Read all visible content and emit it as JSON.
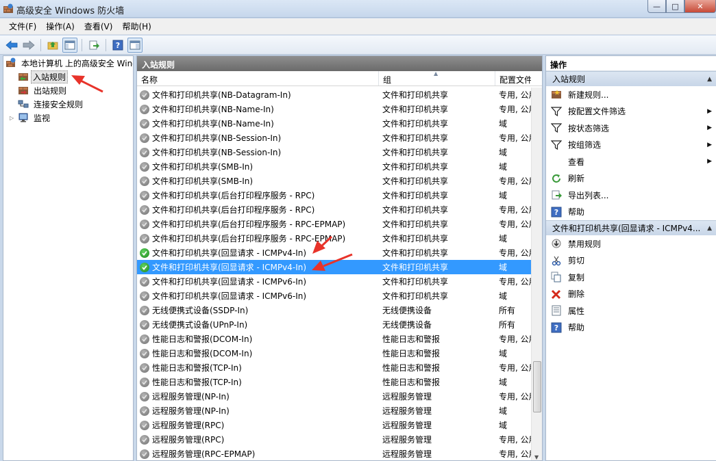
{
  "window": {
    "title": "高级安全 Windows 防火墙",
    "minimize": "—",
    "maximize": "□",
    "close": "✕"
  },
  "menu": [
    "文件(F)",
    "操作(A)",
    "查看(V)",
    "帮助(H)"
  ],
  "toolbar": {
    "buttons": [
      "back-icon",
      "forward-icon",
      "up-folder-icon",
      "show-hide-tree-icon",
      "export-list-icon",
      "help-icon",
      "properties-icon"
    ]
  },
  "tree": {
    "root": "本地计算机 上的高级安全 Windows",
    "items": [
      {
        "label": "入站规则",
        "selected": true
      },
      {
        "label": "出站规则",
        "selected": false
      },
      {
        "label": "连接安全规则",
        "selected": false
      },
      {
        "label": "监视",
        "selected": false,
        "expandable": true
      }
    ]
  },
  "center": {
    "title": "入站规则",
    "columns": {
      "name": "名称",
      "group": "组",
      "profile": "配置文件"
    },
    "rows": [
      {
        "name": "文件和打印机共享(NB-Datagram-In)",
        "group": "文件和打印机共享",
        "profile": "专用, 公用",
        "enabled": false,
        "selected": false
      },
      {
        "name": "文件和打印机共享(NB-Name-In)",
        "group": "文件和打印机共享",
        "profile": "专用, 公用",
        "enabled": false,
        "selected": false
      },
      {
        "name": "文件和打印机共享(NB-Name-In)",
        "group": "文件和打印机共享",
        "profile": "域",
        "enabled": false,
        "selected": false
      },
      {
        "name": "文件和打印机共享(NB-Session-In)",
        "group": "文件和打印机共享",
        "profile": "专用, 公用",
        "enabled": false,
        "selected": false
      },
      {
        "name": "文件和打印机共享(NB-Session-In)",
        "group": "文件和打印机共享",
        "profile": "域",
        "enabled": false,
        "selected": false
      },
      {
        "name": "文件和打印机共享(SMB-In)",
        "group": "文件和打印机共享",
        "profile": "域",
        "enabled": false,
        "selected": false
      },
      {
        "name": "文件和打印机共享(SMB-In)",
        "group": "文件和打印机共享",
        "profile": "专用, 公用",
        "enabled": false,
        "selected": false
      },
      {
        "name": "文件和打印机共享(后台打印程序服务 - RPC)",
        "group": "文件和打印机共享",
        "profile": "域",
        "enabled": false,
        "selected": false
      },
      {
        "name": "文件和打印机共享(后台打印程序服务 - RPC)",
        "group": "文件和打印机共享",
        "profile": "专用, 公用",
        "enabled": false,
        "selected": false
      },
      {
        "name": "文件和打印机共享(后台打印程序服务 - RPC-EPMAP)",
        "group": "文件和打印机共享",
        "profile": "专用, 公用",
        "enabled": false,
        "selected": false
      },
      {
        "name": "文件和打印机共享(后台打印程序服务 - RPC-EPMAP)",
        "group": "文件和打印机共享",
        "profile": "域",
        "enabled": false,
        "selected": false
      },
      {
        "name": "文件和打印机共享(回显请求 - ICMPv4-In)",
        "group": "文件和打印机共享",
        "profile": "专用, 公用",
        "enabled": true,
        "selected": false
      },
      {
        "name": "文件和打印机共享(回显请求 - ICMPv4-In)",
        "group": "文件和打印机共享",
        "profile": "域",
        "enabled": true,
        "selected": true
      },
      {
        "name": "文件和打印机共享(回显请求 - ICMPv6-In)",
        "group": "文件和打印机共享",
        "profile": "专用, 公用",
        "enabled": false,
        "selected": false
      },
      {
        "name": "文件和打印机共享(回显请求 - ICMPv6-In)",
        "group": "文件和打印机共享",
        "profile": "域",
        "enabled": false,
        "selected": false
      },
      {
        "name": "无线便携式设备(SSDP-In)",
        "group": "无线便携设备",
        "profile": "所有",
        "enabled": false,
        "selected": false
      },
      {
        "name": "无线便携式设备(UPnP-In)",
        "group": "无线便携设备",
        "profile": "所有",
        "enabled": false,
        "selected": false
      },
      {
        "name": "性能日志和警报(DCOM-In)",
        "group": "性能日志和警报",
        "profile": "专用, 公用",
        "enabled": false,
        "selected": false
      },
      {
        "name": "性能日志和警报(DCOM-In)",
        "group": "性能日志和警报",
        "profile": "域",
        "enabled": false,
        "selected": false
      },
      {
        "name": "性能日志和警报(TCP-In)",
        "group": "性能日志和警报",
        "profile": "专用, 公用",
        "enabled": false,
        "selected": false
      },
      {
        "name": "性能日志和警报(TCP-In)",
        "group": "性能日志和警报",
        "profile": "域",
        "enabled": false,
        "selected": false
      },
      {
        "name": "远程服务管理(NP-In)",
        "group": "远程服务管理",
        "profile": "专用, 公用",
        "enabled": false,
        "selected": false
      },
      {
        "name": "远程服务管理(NP-In)",
        "group": "远程服务管理",
        "profile": "域",
        "enabled": false,
        "selected": false
      },
      {
        "name": "远程服务管理(RPC)",
        "group": "远程服务管理",
        "profile": "域",
        "enabled": false,
        "selected": false
      },
      {
        "name": "远程服务管理(RPC)",
        "group": "远程服务管理",
        "profile": "专用, 公用",
        "enabled": false,
        "selected": false
      },
      {
        "name": "远程服务管理(RPC-EPMAP)",
        "group": "远程服务管理",
        "profile": "专用, 公用",
        "enabled": false,
        "selected": false
      }
    ]
  },
  "actions": {
    "title": "操作",
    "section1": {
      "title": "入站规则",
      "items": [
        {
          "label": "新建规则...",
          "icon": "new-rule-icon",
          "submenu": false
        },
        {
          "label": "按配置文件筛选",
          "icon": "filter-icon",
          "submenu": true
        },
        {
          "label": "按状态筛选",
          "icon": "filter-icon",
          "submenu": true
        },
        {
          "label": "按组筛选",
          "icon": "filter-icon",
          "submenu": true
        },
        {
          "label": "查看",
          "icon": "",
          "submenu": true
        },
        {
          "label": "刷新",
          "icon": "refresh-icon",
          "submenu": false
        },
        {
          "label": "导出列表...",
          "icon": "export-list-icon",
          "submenu": false
        },
        {
          "label": "帮助",
          "icon": "help-icon",
          "submenu": false
        }
      ]
    },
    "section2": {
      "title": "文件和打印机共享(回显请求 - ICMPv4...",
      "items": [
        {
          "label": "禁用规则",
          "icon": "disable-rule-icon"
        },
        {
          "label": "剪切",
          "icon": "cut-icon"
        },
        {
          "label": "复制",
          "icon": "copy-icon"
        },
        {
          "label": "删除",
          "icon": "delete-icon"
        },
        {
          "label": "属性",
          "icon": "properties-icon"
        },
        {
          "label": "帮助",
          "icon": "help-icon"
        }
      ]
    }
  },
  "colors": {
    "selection": "#3399ff",
    "annotation_arrow": "#e8332a",
    "pane_header": "#7a7a7a"
  }
}
